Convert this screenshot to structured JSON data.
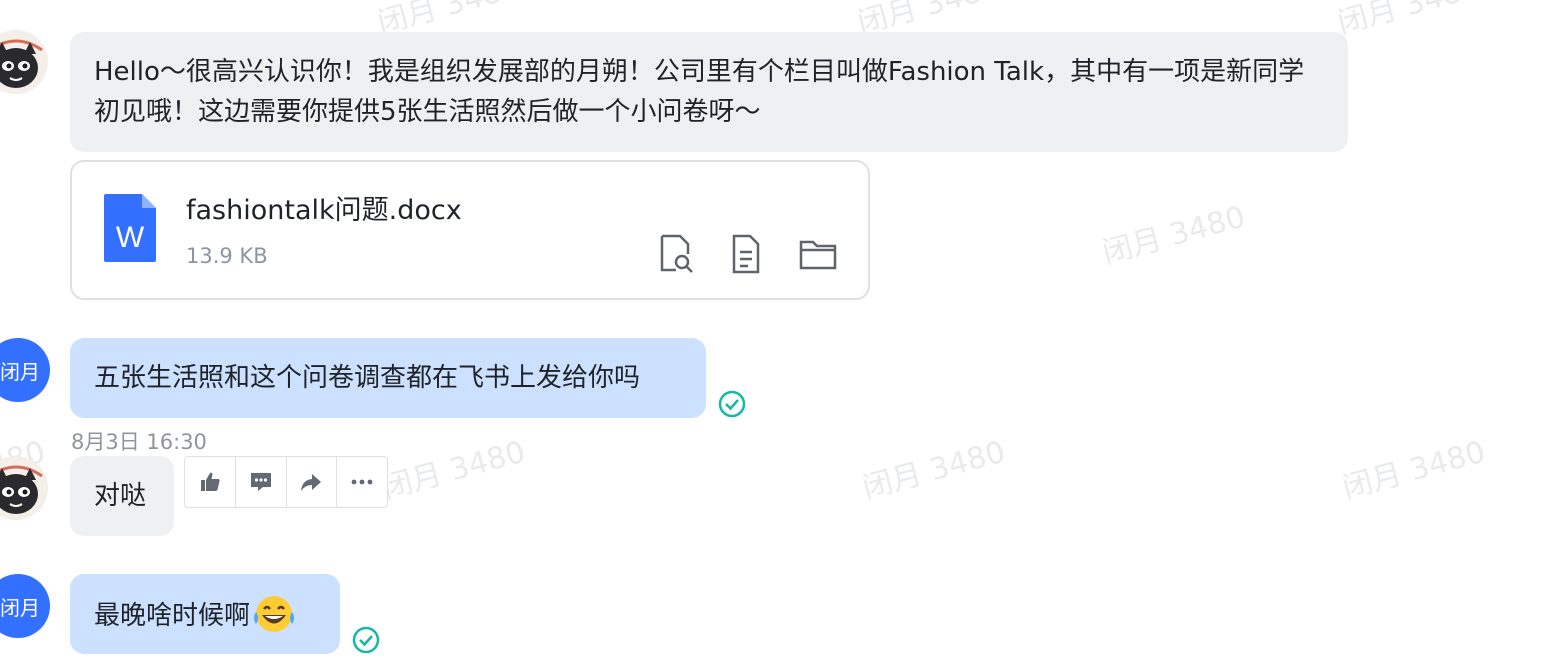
{
  "watermark": {
    "text": "闭月 3480"
  },
  "messages": [
    {
      "text": "Hello～很高兴认识你！我是组织发展部的月朔！公司里有个栏目叫做Fashion Talk，其中有一项是新同学初见哦！这边需要你提供5张生活照然后做一个小问卷呀～"
    },
    {
      "file_name": "fashiontalk问题.docx",
      "file_size": "13.9 KB",
      "file_icon_letter": "W"
    },
    {
      "sender_avatar_text": "闭月",
      "text": "五张生活照和这个问卷调查都在飞书上发给你吗"
    },
    {
      "timestamp": "8月3日 16:30",
      "text": "对哒"
    },
    {
      "sender_avatar_text": "闭月",
      "text": "最晚啥时候啊",
      "emoji": "😂"
    }
  ],
  "file_actions": [
    "preview-icon",
    "document-icon",
    "folder-icon"
  ],
  "toolbar_actions": [
    "thumbs-up-icon",
    "comment-icon",
    "forward-icon",
    "more-icon"
  ],
  "colors": {
    "gray_bubble": "#eff0f1",
    "blue_bubble": "#cce0ff",
    "avatar_blue": "#3370ff",
    "read_check": "#14b8a6",
    "word_icon": "#3370ff"
  }
}
